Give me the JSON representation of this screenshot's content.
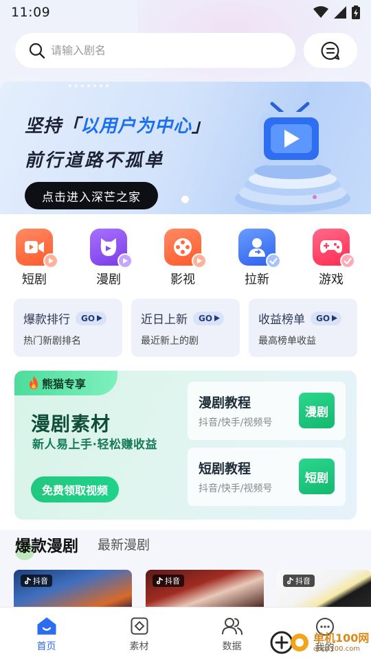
{
  "status_bar": {
    "time": "11:09"
  },
  "search": {
    "placeholder": "请输入剧名"
  },
  "banner": {
    "line1_prefix": "坚持「",
    "line1_highlight": "以用户为中心",
    "line1_suffix": "」",
    "line2": "前行道路不孤单",
    "button": "点击进入深芒之家"
  },
  "categories": [
    {
      "label": "短剧",
      "icon": "video-camera-icon",
      "color": "#ff6a3d"
    },
    {
      "label": "漫剧",
      "icon": "cartoon-cat-icon",
      "color": "#8a4cf0"
    },
    {
      "label": "影视",
      "icon": "film-reel-icon",
      "color": "#ff6a3d"
    },
    {
      "label": "拉新",
      "icon": "invite-user-icon",
      "color": "#3d7cf5"
    },
    {
      "label": "游戏",
      "icon": "gamepad-icon",
      "color": "#ff3d64"
    }
  ],
  "rank_cards": [
    {
      "title": "爆款排行",
      "go": "GO",
      "subtitle": "热门新剧排名"
    },
    {
      "title": "近日上新",
      "go": "GO",
      "subtitle": "最近新上的剧"
    },
    {
      "title": "收益榜单",
      "go": "GO",
      "subtitle": "最高榜单收益"
    }
  ],
  "panda": {
    "tag": "熊猫专享",
    "title": "漫剧素材",
    "subtitle": "新人易上手·轻松赚收益",
    "button": "免费领取视频",
    "tutorials": [
      {
        "title": "漫剧教程",
        "platforms": "抖音/快手/视频号",
        "badge": "漫剧"
      },
      {
        "title": "短剧教程",
        "platforms": "抖音/快手/视频号",
        "badge": "短剧"
      }
    ]
  },
  "drama_tabs": {
    "active": "爆款漫剧",
    "other": "最新漫剧"
  },
  "thumbnails": [
    {
      "platform": "抖音"
    },
    {
      "platform": "抖音"
    },
    {
      "platform": "抖音"
    }
  ],
  "bottom_nav": [
    {
      "label": "首页",
      "icon": "home-icon",
      "active": true
    },
    {
      "label": "素材",
      "icon": "material-icon",
      "active": false
    },
    {
      "label": "数据",
      "icon": "users-data-icon",
      "active": false
    },
    {
      "label": "我的",
      "icon": "profile-icon",
      "active": false
    }
  ],
  "watermark": {
    "line1": "单机100网",
    "line2": "danji100.com"
  },
  "colors": {
    "accent": "#2c6cf0",
    "green": "#1fd28a"
  }
}
